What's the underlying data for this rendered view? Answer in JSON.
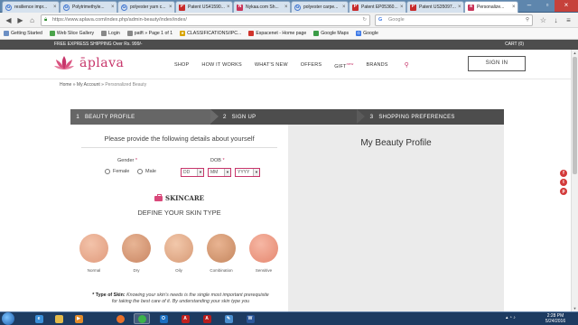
{
  "browser": {
    "tabs": [
      {
        "title": "resilience impr...",
        "icon": "google-icon",
        "active": false
      },
      {
        "title": "Polytrimethyle...",
        "icon": "google-icon",
        "active": false
      },
      {
        "title": "polyester yarn c...",
        "icon": "google-icon",
        "active": false
      },
      {
        "title": "Patent US41590...",
        "icon": "google-icon",
        "active": false
      },
      {
        "title": "Nykaa.com Sh...",
        "icon": "google-icon",
        "active": false
      },
      {
        "title": "polyester carpe...",
        "icon": "google-icon",
        "active": false
      },
      {
        "title": "Patent EP05360...",
        "icon": "google-icon",
        "active": false
      },
      {
        "title": "Patent US35097...",
        "icon": "google-icon",
        "active": false
      },
      {
        "title": "Personalize...",
        "icon": "aplava-icon",
        "active": true
      }
    ],
    "url": "https://www.aplava.com/index.php/admin-beauty/index/index/",
    "search_placeholder": "Google",
    "bookmarks": [
      {
        "label": "Getting Started",
        "icon": "page-icon",
        "color": "#6b8fc4"
      },
      {
        "label": "Web Slice Gallery",
        "icon": "slice-icon",
        "color": "#4aa34a"
      },
      {
        "label": "Login",
        "icon": "page-icon",
        "color": "#888888"
      },
      {
        "label": "patft » Page 1 of 1",
        "icon": "page-icon",
        "color": "#888888"
      },
      {
        "label": "CLASSIFICATIONS/IPC...",
        "icon": "star-icon",
        "color": "#d8a400"
      },
      {
        "label": "Espacenet - Home page",
        "icon": "page-icon",
        "color": "#d0342c"
      },
      {
        "label": "Google Maps",
        "icon": "maps-icon",
        "color": "#3b9c47"
      },
      {
        "label": "Google",
        "icon": "google-icon",
        "color": "#3b78e7"
      }
    ]
  },
  "promo": {
    "left": "FREE EXPRESS SHIPPING Over Rs. 999/-",
    "right": "CART (0)"
  },
  "site": {
    "logo_text": "āplava",
    "nav": [
      "SHOP",
      "HOW IT WORKS",
      "WHAT'S NEW",
      "OFFERS",
      "GIFT",
      "BRANDS"
    ],
    "gift_badge": "new",
    "signin": "SIGN IN",
    "accent": "#c7356a"
  },
  "breadcrumb": {
    "home": "Home",
    "sep": "»",
    "account": "My Account",
    "current": "Personalized Beauty"
  },
  "steps": [
    {
      "num": "1",
      "label": "BEAUTY PROFILE",
      "active": true
    },
    {
      "num": "2",
      "label": "SIGN UP",
      "active": false
    },
    {
      "num": "3",
      "label": "SHOPPING PREFERENCES",
      "active": false
    }
  ],
  "form": {
    "intro": "Please provide the following details about yourself",
    "gender_label": "Gender",
    "req": "*",
    "female": "Female",
    "male": "Male",
    "dob_label": "DOB",
    "dd": "DD",
    "mm": "MM",
    "yyyy": "YYYY",
    "section": "SKINCARE",
    "define": "DEFINE YOUR SKIN TYPE",
    "skin_types": [
      {
        "label": "Normal",
        "color": "#e9a98e"
      },
      {
        "label": "Dry",
        "color": "#d99a7a"
      },
      {
        "label": "Oily",
        "color": "#e5ae8c"
      },
      {
        "label": "Combination",
        "color": "#d49b78"
      },
      {
        "label": "Sensitive",
        "color": "#ee9f8a"
      }
    ],
    "note_title": "* Type of Skin:",
    "note_body": "Knowing your skin's needs is the single most important prerequisite for taking the best care of it. By understanding your skin type you"
  },
  "profile": {
    "title": "My Beauty Profile"
  },
  "social": [
    "f",
    "t",
    "p"
  ],
  "taskbar": {
    "time": "2:28 PM",
    "date": "5/24/2016",
    "apps": [
      {
        "name": "ie",
        "letter": "e",
        "color": "#3a8fd9"
      },
      {
        "name": "explorer",
        "letter": "▭",
        "color": "#e3b94a"
      },
      {
        "name": "media",
        "letter": "▶",
        "color": "#e28b2a"
      },
      {
        "name": "firefox",
        "letter": "◉",
        "color": "#e8702a"
      },
      {
        "name": "chrome",
        "letter": "◉",
        "color": "#3bb34a"
      },
      {
        "name": "outlook",
        "letter": "O",
        "color": "#1a6ec0"
      },
      {
        "name": "acrobat",
        "letter": "A",
        "color": "#c0201d"
      },
      {
        "name": "acrobat2",
        "letter": "A",
        "color": "#b71c1c"
      },
      {
        "name": "paint",
        "letter": "✎",
        "color": "#4a8fd0"
      },
      {
        "name": "word",
        "letter": "W",
        "color": "#2a5699"
      }
    ]
  }
}
